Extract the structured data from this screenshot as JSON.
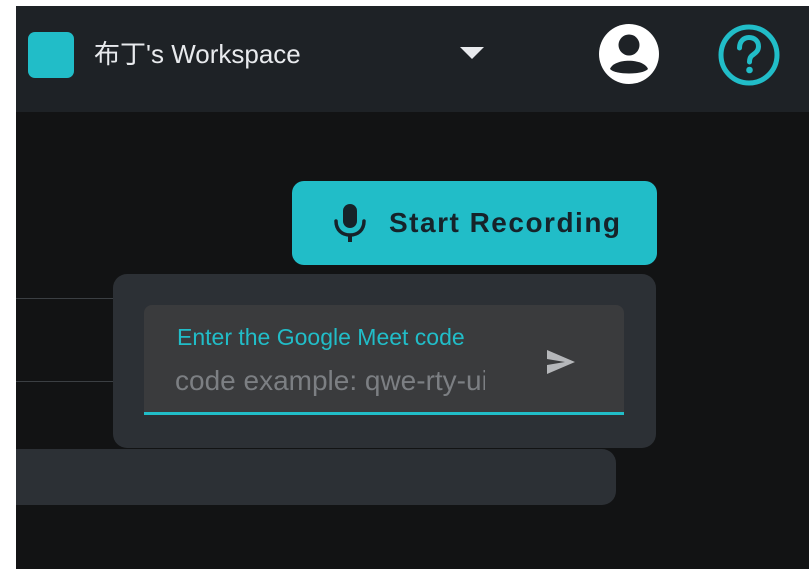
{
  "header": {
    "workspace_name": "布丁's Workspace",
    "brand_color": "#21bdc8"
  },
  "icons": {
    "caret": "caret-down-icon",
    "account": "account-circle-icon",
    "help": "help-circle-icon",
    "mic": "mic-icon",
    "send": "send-icon"
  },
  "recording": {
    "button_label": "Start Recording"
  },
  "meet": {
    "field_label": "Enter the Google Meet code",
    "placeholder": "code example: qwe-rty-uio",
    "value": ""
  }
}
